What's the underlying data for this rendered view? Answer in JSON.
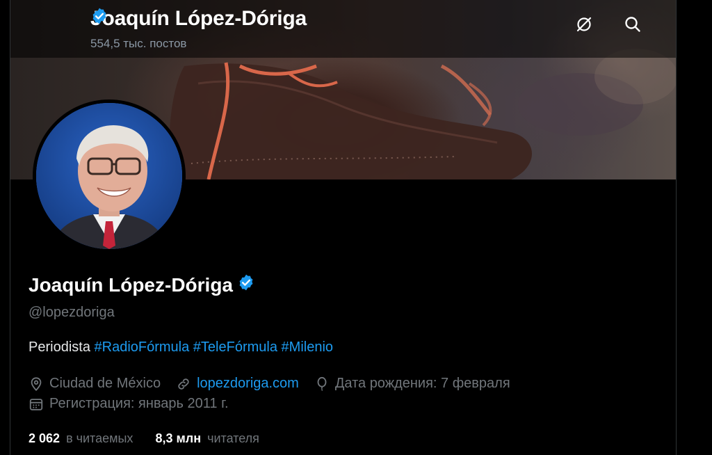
{
  "header": {
    "name": "Joaquín López-Dóriga",
    "posts_count": "554,5 тыс. постов"
  },
  "profile": {
    "display_name": "Joaquín López-Dóriga",
    "handle": "@lopezdoriga",
    "bio_text": "Periodista",
    "bio_hashtags": [
      "#RadioFórmula",
      "#TeleFórmula",
      "#Milenio"
    ],
    "location": "Ciudad de México",
    "website": "lopezdoriga.com",
    "birthday": "Дата рождения: 7 февраля",
    "joined": "Регистрация: январь 2011 г.",
    "following_count": "2 062",
    "following_label": "в читаемых",
    "followers_count": "8,3 млн",
    "followers_label": "читателя"
  },
  "icons": {
    "verified": "verified-badge-icon",
    "grok": "grok-icon",
    "search": "search-icon",
    "location": "location-pin-icon",
    "link": "link-icon",
    "birthday": "balloon-icon",
    "calendar": "calendar-icon"
  },
  "colors": {
    "accent": "#1d9bf0",
    "muted": "#71767b",
    "text": "#e7e9ea",
    "background": "#000000"
  }
}
